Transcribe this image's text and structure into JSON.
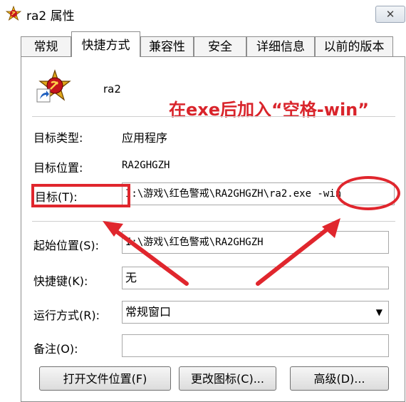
{
  "window": {
    "title": "ra2 属性",
    "close_symbol": "✕"
  },
  "tabs": [
    {
      "label": "常规",
      "active": false
    },
    {
      "label": "快捷方式",
      "active": true
    },
    {
      "label": "兼容性",
      "active": false
    },
    {
      "label": "安全",
      "active": false
    },
    {
      "label": "详细信息",
      "active": false
    },
    {
      "label": "以前的版本",
      "active": false
    }
  ],
  "shortcut": {
    "name": "ra2",
    "icon": "red-alert-2-shortcut-icon",
    "annotation": "在exe后加入“空格-win”",
    "target_type_label": "目标类型:",
    "target_type_value": "应用程序",
    "target_location_label": "目标位置:",
    "target_location_value": "RA2GHGZH",
    "target_label": "目标(T):",
    "target_value": "I:\\游戏\\红色警戒\\RA2GHGZH\\ra2.exe -win",
    "start_in_label": "起始位置(S):",
    "start_in_value": "I:\\游戏\\红色警戒\\RA2GHGZH",
    "hotkey_label": "快捷键(K):",
    "hotkey_value": "无",
    "run_label": "运行方式(R):",
    "run_value": "常规窗口",
    "comment_label": "备注(O):",
    "comment_value": ""
  },
  "buttons": {
    "open_location": "打开文件位置(F)",
    "change_icon": "更改图标(C)...",
    "advanced": "高级(D)..."
  },
  "colors": {
    "annotation": "#d9242b",
    "highlight": "#e0262d"
  }
}
